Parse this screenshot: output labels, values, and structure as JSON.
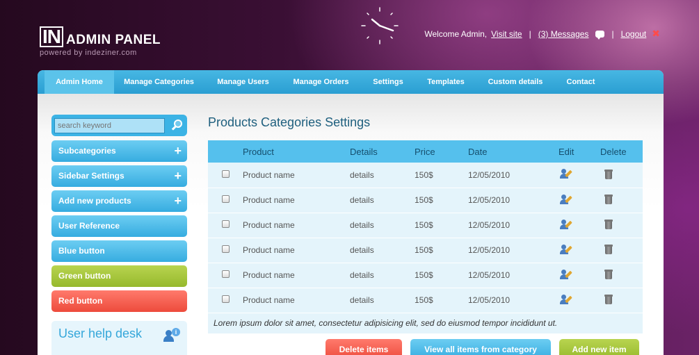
{
  "header": {
    "logo_in": "IN",
    "logo_text": "ADMIN PANEL",
    "logo_sub": "powered by indeziner.com",
    "welcome": "Welcome Admin,",
    "visit_site": "Visit site",
    "messages": "(3) Messages",
    "logout": "Logout",
    "separator": "|"
  },
  "menu": {
    "items": [
      {
        "label": "Admin Home"
      },
      {
        "label": "Manage Categories"
      },
      {
        "label": "Manage Users"
      },
      {
        "label": "Manage Orders"
      },
      {
        "label": "Settings"
      },
      {
        "label": "Templates"
      },
      {
        "label": "Custom details"
      },
      {
        "label": "Contact"
      }
    ]
  },
  "sidebar": {
    "search_placeholder": "search keyword",
    "buttons": [
      {
        "label": "Subcategories",
        "plus": "+"
      },
      {
        "label": "Sidebar Settings",
        "plus": "+"
      },
      {
        "label": "Add new products",
        "plus": "+"
      },
      {
        "label": "User Reference"
      },
      {
        "label": "Blue button"
      },
      {
        "label": "Green button"
      },
      {
        "label": "Red button"
      }
    ],
    "help_title": "User help desk"
  },
  "main": {
    "title": "Products Categories Settings",
    "columns": [
      "Product",
      "Details",
      "Price",
      "Date",
      "Edit",
      "Delete"
    ],
    "rows": [
      {
        "product": "Product name",
        "details": "details",
        "price": "150$",
        "date": "12/05/2010"
      },
      {
        "product": "Product name",
        "details": "details",
        "price": "150$",
        "date": "12/05/2010"
      },
      {
        "product": "Product name",
        "details": "details",
        "price": "150$",
        "date": "12/05/2010"
      },
      {
        "product": "Product name",
        "details": "details",
        "price": "150$",
        "date": "12/05/2010"
      },
      {
        "product": "Product name",
        "details": "details",
        "price": "150$",
        "date": "12/05/2010"
      },
      {
        "product": "Product name",
        "details": "details",
        "price": "150$",
        "date": "12/05/2010"
      }
    ],
    "note": "Lorem ipsum dolor sit amet, consectetur adipisicing elit, sed do eiusmod tempor incididunt ut.",
    "actions": {
      "delete": "Delete items",
      "view_all": "View all items from category",
      "add_new": "Add new item"
    }
  }
}
